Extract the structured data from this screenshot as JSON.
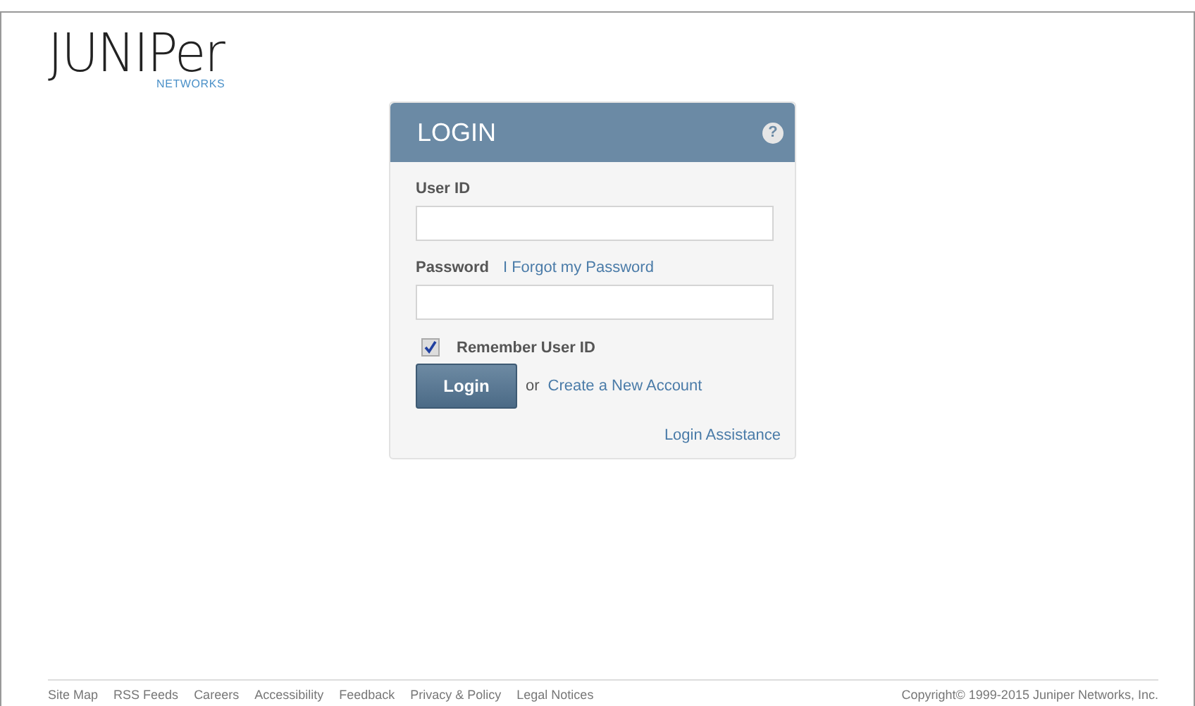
{
  "logo": {
    "wordmark": "JUNIPer",
    "tagline": "NETWORKS"
  },
  "login": {
    "title": "LOGIN",
    "help_icon": "?",
    "user_id": {
      "label": "User ID"
    },
    "password": {
      "label": "Password",
      "forgot_link": "I Forgot my Password"
    },
    "remember": {
      "label": "Remember User ID",
      "checked": true
    },
    "button": "Login",
    "or": "or",
    "create_link": "Create a New Account",
    "assistance_link": "Login Assistance"
  },
  "footer": {
    "links": [
      "Site Map",
      "RSS Feeds",
      "Careers",
      "Accessibility",
      "Feedback",
      "Privacy & Policy",
      "Legal Notices"
    ],
    "copyright": "Copyright© 1999-2015 Juniper Networks, Inc."
  }
}
